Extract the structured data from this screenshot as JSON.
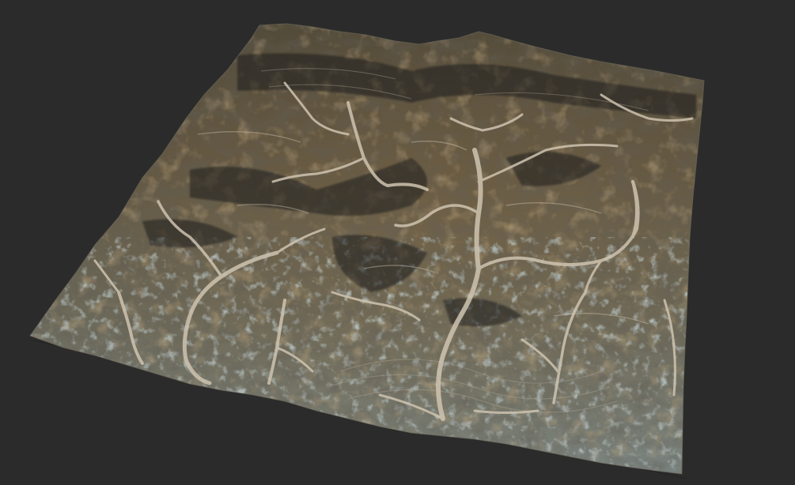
{
  "viewport": {
    "background_color": "#2b2b2b"
  },
  "terrain": {
    "kind": "3d-terrain-heightfield",
    "colors": {
      "rock_dark": "#3b3830",
      "rock_mid": "#6b604b",
      "ochre": "#8a6a3e",
      "lichen_blue": "#7d8f90",
      "riverbed": "#c9bfae",
      "shadow": "#1e1d1a"
    }
  }
}
